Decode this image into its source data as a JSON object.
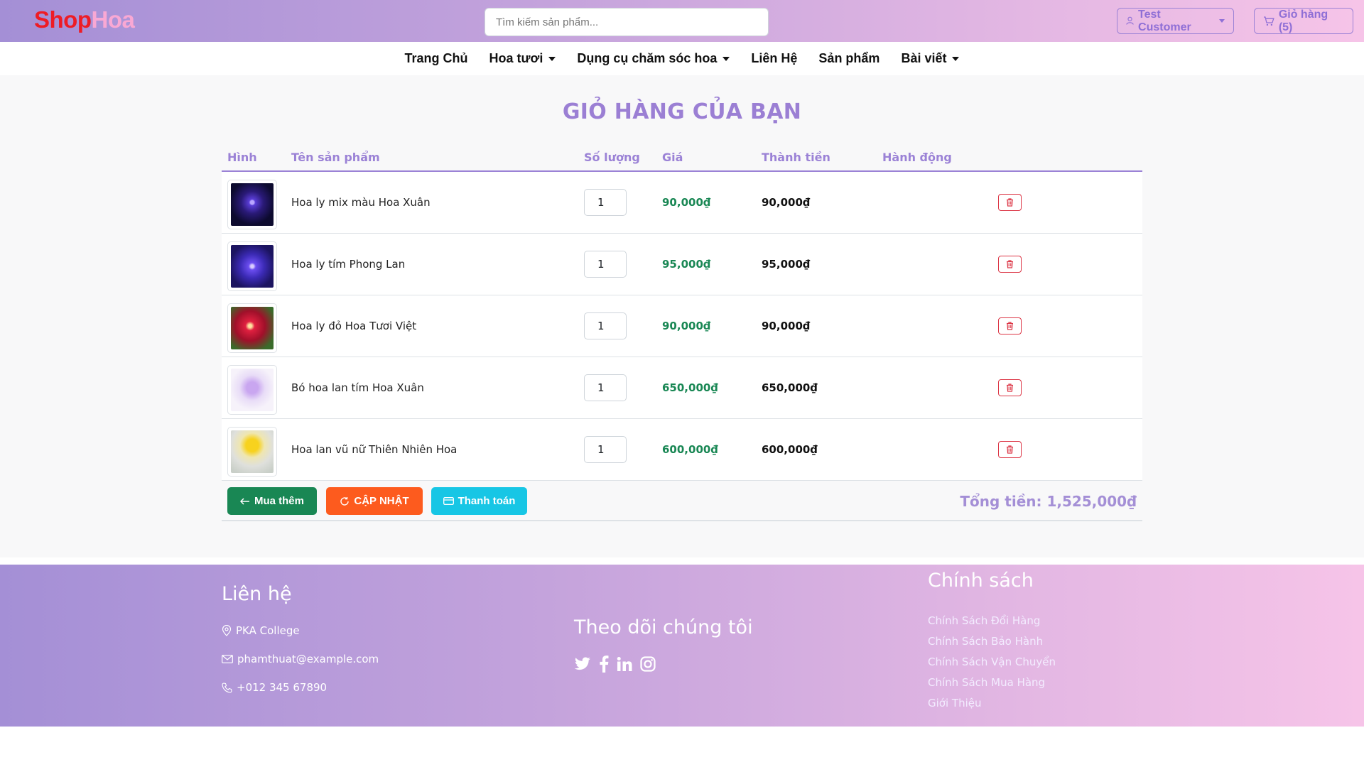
{
  "header": {
    "logo_part1": "Shop",
    "logo_part2": "Hoa",
    "search_placeholder": "Tìm kiếm sản phẩm...",
    "user_label": "Test Customer",
    "cart_label": "Giỏ hàng (5)"
  },
  "nav": {
    "items": [
      {
        "label": "Trang Chủ",
        "dropdown": false
      },
      {
        "label": "Hoa tươi",
        "dropdown": true
      },
      {
        "label": "Dụng cụ chăm sóc hoa",
        "dropdown": true
      },
      {
        "label": "Liên Hệ",
        "dropdown": false
      },
      {
        "label": "Sản phẩm",
        "dropdown": false
      },
      {
        "label": "Bài viết",
        "dropdown": true
      }
    ]
  },
  "cart": {
    "title": "GIỎ HÀNG CỦA BẠN",
    "columns": [
      "Hình",
      "Tên sản phẩm",
      "Số lượng",
      "Giá",
      "Thành tiền",
      "Hành động"
    ],
    "items": [
      {
        "name": "Hoa ly mix màu Hoa Xuân",
        "qty": "1",
        "price": "90,000₫",
        "subtotal": "90,000₫",
        "image": "purple-lily-mix"
      },
      {
        "name": "Hoa ly tím Phong Lan",
        "qty": "1",
        "price": "95,000₫",
        "subtotal": "95,000₫",
        "image": "purple-lily"
      },
      {
        "name": "Hoa ly đỏ Hoa Tươi Việt",
        "qty": "1",
        "price": "90,000₫",
        "subtotal": "90,000₫",
        "image": "red-lily"
      },
      {
        "name": "Bó hoa lan tím Hoa Xuân",
        "qty": "1",
        "price": "650,000₫",
        "subtotal": "650,000₫",
        "image": "purple-orchid-bouquet"
      },
      {
        "name": "Hoa lan vũ nữ Thiên Nhiên Hoa",
        "qty": "1",
        "price": "600,000₫",
        "subtotal": "600,000₫",
        "image": "yellow-dancing-orchid"
      }
    ],
    "buttons": {
      "more": "Mua thêm",
      "update": "CẬP NHẬT",
      "pay": "Thanh toán"
    },
    "total": "Tổng tiền: 1,525,000₫"
  },
  "footer": {
    "contact_heading": "Liên hệ",
    "address": "PKA College",
    "email": "phamthuat@example.com",
    "phone": "+012 345 67890",
    "follow_heading": "Theo dõi chúng tôi",
    "social": [
      "twitter-icon",
      "facebook-icon",
      "linkedin-icon",
      "instagram-icon"
    ],
    "policy_heading": "Chính sách",
    "policy_links": [
      "Chính Sách Đổi Hàng",
      "Chính Sách Bảo Hành",
      "Chính Sách Vận Chuyển",
      "Chính Sách Mua Hàng",
      "Giới Thiệu"
    ]
  },
  "colors": {
    "accent": "#9b82d6",
    "price_green": "#198754",
    "danger": "#dc3545",
    "update_orange": "#fd5b1e",
    "pay_cyan": "#17c6e5",
    "logo_red": "#ee1c25",
    "logo_pink": "#f9a8d4"
  }
}
